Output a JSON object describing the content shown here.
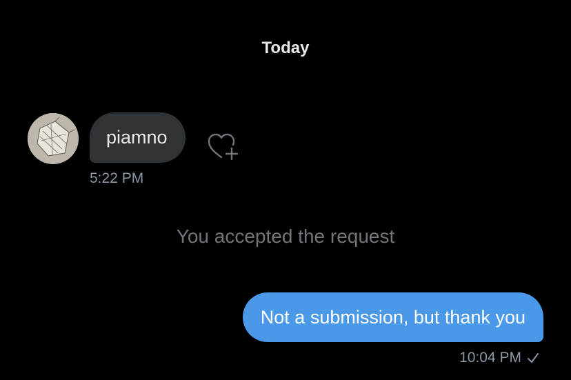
{
  "thread": {
    "day_label": "Today",
    "incoming": {
      "text": "piamno",
      "time": "5:22 PM",
      "react_icon": "heart-plus-icon",
      "avatar_icon": "avatar-photo"
    },
    "system_message": "You accepted the request",
    "outgoing": {
      "text": "Not a submission, but thank you",
      "time": "10:04 PM",
      "status_icon": "check-icon"
    }
  },
  "colors": {
    "background": "#000000",
    "incoming_bubble": "#2f3336",
    "outgoing_bubble": "#4a99e9",
    "primary_text": "#e7e9ea",
    "secondary_text": "#71767b",
    "timestamp_text": "#8b98a5"
  }
}
